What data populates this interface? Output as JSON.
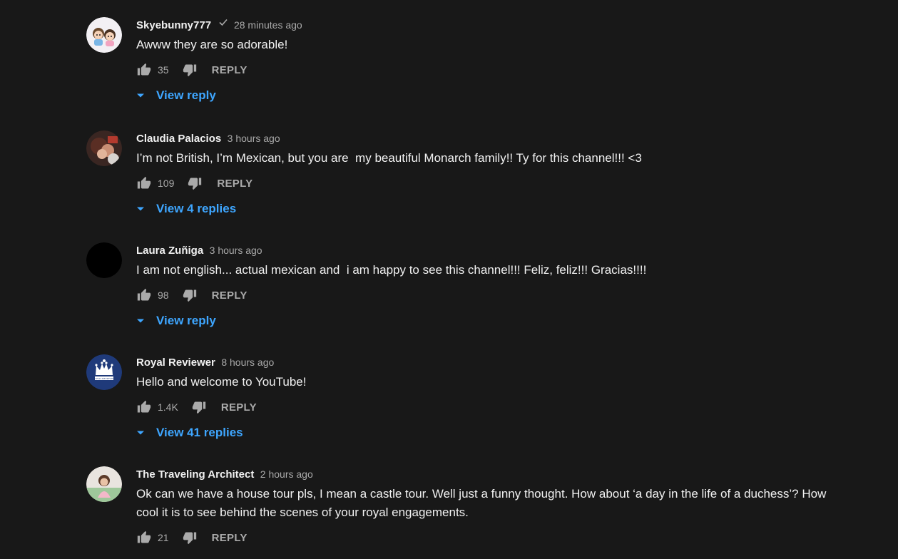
{
  "comments": [
    {
      "author": "Skyebunny777",
      "verified": true,
      "timestamp": "28 minutes ago",
      "text": "Awww they are so adorable!",
      "likes": "35",
      "reply_label": "REPLY",
      "view_replies": "View reply",
      "avatar": "cartoon-couple-avatar"
    },
    {
      "author": "Claudia Palacios",
      "verified": false,
      "timestamp": "3 hours ago",
      "text": "I’m not British, I’m Mexican, but you are  my beautiful Monarch family!! Ty for this channel!!! <3",
      "likes": "109",
      "reply_label": "REPLY",
      "view_replies": "View 4 replies",
      "avatar": "photo-avatar"
    },
    {
      "author": "Laura Zuñiga",
      "verified": false,
      "timestamp": "3 hours ago",
      "text": "I am not english... actual mexican and  i am happy to see this channel!!! Feliz, feliz!!! Gracias!!!!",
      "likes": "98",
      "reply_label": "REPLY",
      "view_replies": "View reply",
      "avatar": "black-avatar"
    },
    {
      "author": "Royal Reviewer",
      "verified": false,
      "timestamp": "8 hours ago",
      "text": "Hello and welcome to YouTube!",
      "likes": "1.4K",
      "reply_label": "REPLY",
      "view_replies": "View 41 replies",
      "avatar": "crown-logo-avatar",
      "avatar_text": "ROYAL REVIEWER"
    },
    {
      "author": "The Traveling Architect",
      "verified": false,
      "timestamp": "2 hours ago",
      "text": "Ok can we have a house tour pls, I mean a castle tour. Well just a funny thought. How about ‘a day in the life of a duchess’? How cool it is to see behind the scenes of your royal engagements.",
      "likes": "21",
      "reply_label": "REPLY",
      "view_replies": null,
      "avatar": "portrait-avatar"
    }
  ],
  "colors": {
    "background": "#181818",
    "text": "#f1f1f1",
    "secondary": "#aaaaaa",
    "link": "#3ea6ff",
    "royal_blue": "#1f3a7a"
  }
}
